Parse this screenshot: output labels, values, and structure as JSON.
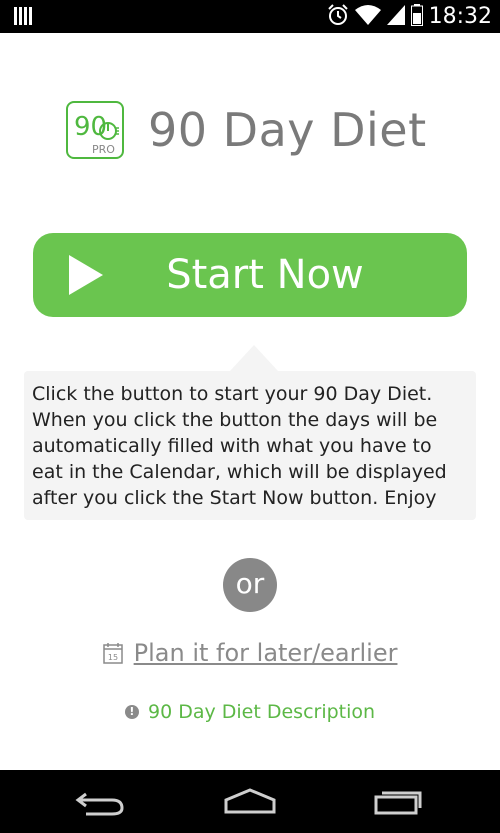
{
  "status_bar": {
    "time": "18:32",
    "icons": [
      "notification-icon",
      "alarm-icon",
      "wifi-icon",
      "signal-icon",
      "battery-icon"
    ]
  },
  "app": {
    "logo": {
      "number": "90",
      "badge": "PRO"
    },
    "title": "90 Day Diet",
    "start_button": {
      "label": "Start Now",
      "color": "#6ac54f"
    },
    "tooltip_text": "Click the button to start your 90 Day Diet. When you click the button the days will be automatically filled with what you have to eat in the Calendar, which will be displayed after you click the Start Now button. Enjoy",
    "or_label": "or",
    "plan_link": {
      "icon_day": "15",
      "label": "Plan it for later/earlier"
    },
    "description_link": {
      "label": "90 Day Diet Description",
      "color": "#5cb846"
    }
  },
  "nav_bar": {
    "icons": [
      "back-icon",
      "home-icon",
      "recent-apps-icon"
    ]
  }
}
